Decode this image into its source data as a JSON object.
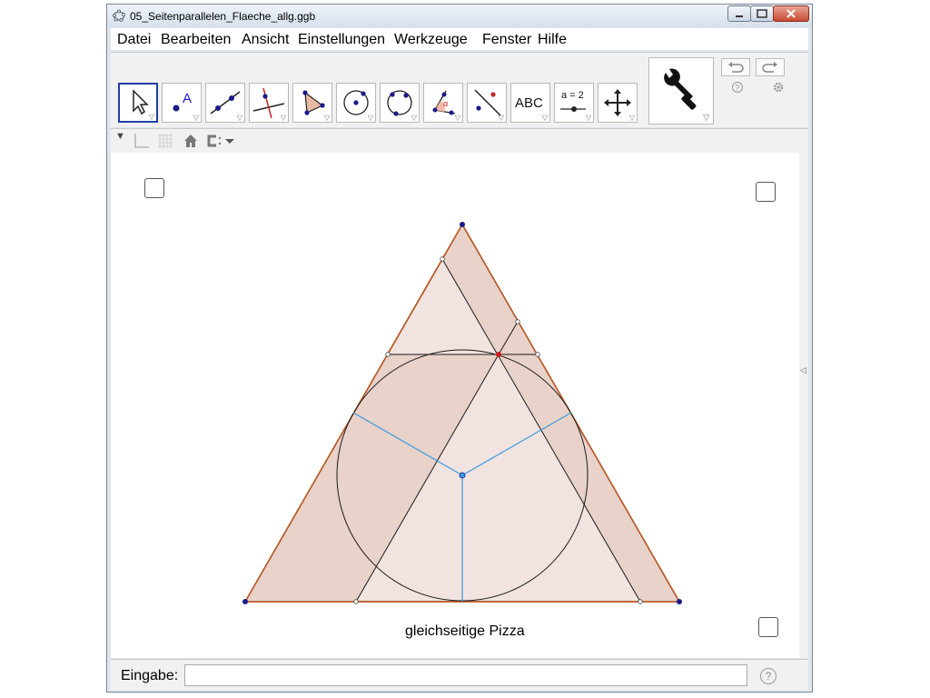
{
  "window": {
    "title": "05_Seitenparallelen_Flaeche_allg.ggb"
  },
  "menu": [
    "Datei",
    "Bearbeiten",
    "Ansicht",
    "Einstellungen",
    "Werkzeuge",
    "Fenster",
    "Hilfe"
  ],
  "toolbar": {
    "tools": [
      {
        "name": "move-tool-icon"
      },
      {
        "name": "point-tool-icon",
        "glyph": "A"
      },
      {
        "name": "line-tool-icon"
      },
      {
        "name": "perpendicular-line-tool-icon"
      },
      {
        "name": "polygon-tool-icon"
      },
      {
        "name": "circle-center-point-tool-icon"
      },
      {
        "name": "circle-three-points-tool-icon"
      },
      {
        "name": "angle-tool-icon",
        "glyph": "α"
      },
      {
        "name": "reflect-tool-icon"
      },
      {
        "name": "text-tool-icon",
        "label": "ABC"
      },
      {
        "name": "slider-tool-icon",
        "label": "a = 2"
      },
      {
        "name": "move-graphics-view-tool-icon"
      }
    ],
    "undo_icon": "undo-icon",
    "redo_icon": "redo-icon",
    "help_icon": "help-icon",
    "settings_icon": "gear-icon",
    "customize_icon": "wrench-icon"
  },
  "graphics": {
    "label": "gleichseitige Pizza",
    "colors": {
      "triangle_edge": "#b5531f",
      "fill": "#f1e3df",
      "strip_fill": "#e6cfc6",
      "line": "#1a1a1a",
      "radius": "#3b9be0",
      "vertex": "#1a1a8a",
      "highlight_point": "#cc1a1a"
    }
  },
  "inputbar": {
    "label": "Eingabe:",
    "value": "",
    "help": "?"
  }
}
